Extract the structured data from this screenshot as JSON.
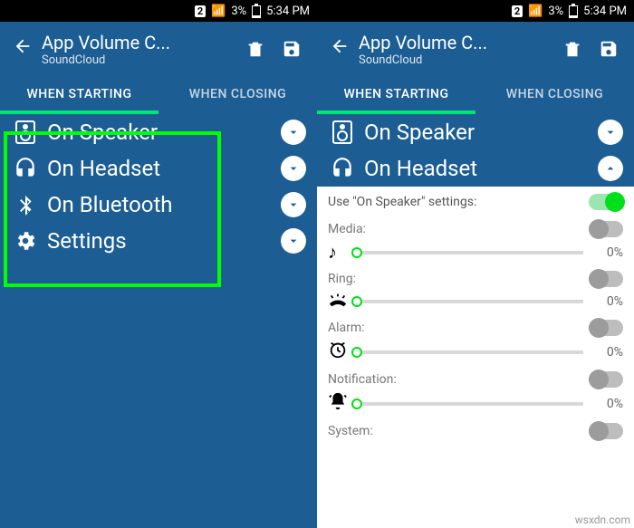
{
  "status": {
    "sim": "2",
    "battery": "3%",
    "time": "5:34 PM"
  },
  "header": {
    "title": "App Volume C...",
    "subtitle": "SoundCloud"
  },
  "tabs": {
    "start": "WHEN STARTING",
    "close": "WHEN CLOSING",
    "active": "start"
  },
  "options": {
    "speaker": "On Speaker",
    "headset": "On Headset",
    "bluetooth": "On Bluetooth",
    "settings": "Settings"
  },
  "panel": {
    "use_speaker_label": "Use \"On Speaker\" settings:",
    "use_speaker_on": true,
    "sections": [
      {
        "label": "Media:",
        "icon": "note",
        "pct": "0%",
        "toggle": false
      },
      {
        "label": "Ring:",
        "icon": "ring",
        "pct": "0%",
        "toggle": false
      },
      {
        "label": "Alarm:",
        "icon": "alarm",
        "pct": "0%",
        "toggle": false
      },
      {
        "label": "Notification:",
        "icon": "bell",
        "pct": "0%",
        "toggle": false
      },
      {
        "label": "System:",
        "icon": "",
        "pct": "",
        "toggle": false
      }
    ]
  },
  "watermark": "wsxdn.com"
}
